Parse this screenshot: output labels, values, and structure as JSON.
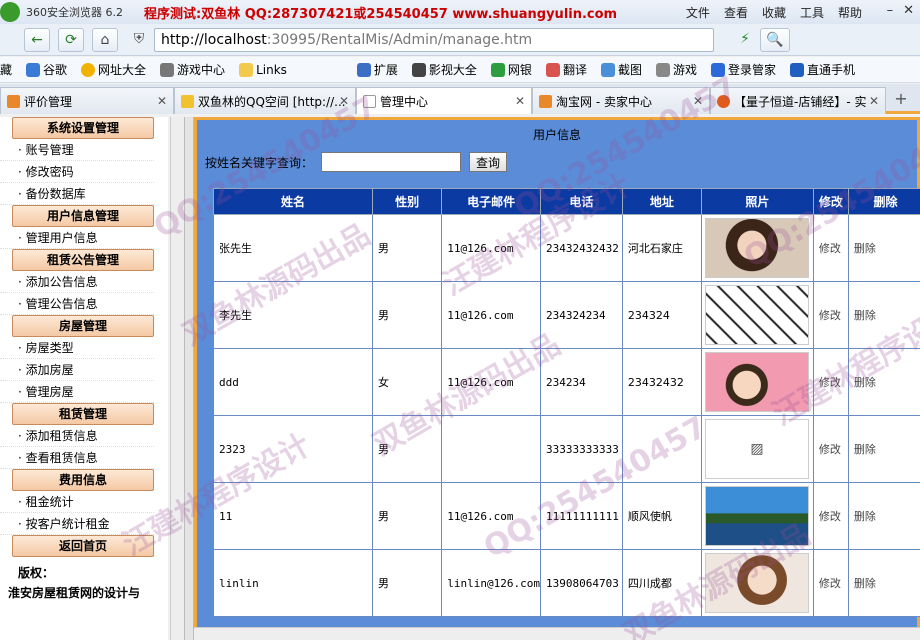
{
  "browser": {
    "app_title": "360安全浏览器 6.2",
    "ad_text": "程序测试:双鱼林 QQ:287307421或254540457 www.shuangyulin.com",
    "menu": [
      "文件",
      "查看",
      "收藏",
      "工具",
      "帮助"
    ],
    "url_host": "http://localhost",
    "url_path": ":30995/RentalMis/Admin/manage.htm",
    "bookmarks": [
      "藏",
      "谷歌",
      "网址大全",
      "游戏中心",
      "Links",
      "扩展",
      "影视大全",
      "网银",
      "翻译",
      "截图",
      "游戏",
      "登录管家",
      "直通手机"
    ],
    "tabs": [
      {
        "label": "评价管理",
        "color": "#e8882a"
      },
      {
        "label": "双鱼林的QQ空间 [http://...",
        "color": "#f2c12e"
      },
      {
        "label": "管理中心",
        "color": "#ffffff"
      },
      {
        "label": "淘宝网 - 卖家中心",
        "color": "#e8882a"
      },
      {
        "label": "【量子恒道-店铺经】- 实",
        "color": "#e05a1a"
      }
    ]
  },
  "sidebar": {
    "sections": [
      {
        "title": "系统设置管理",
        "items": [
          "账号管理",
          "修改密码",
          "备份数据库"
        ]
      },
      {
        "title": "用户信息管理",
        "items": [
          "管理用户信息"
        ]
      },
      {
        "title": "租赁公告管理",
        "items": [
          "添加公告信息",
          "管理公告信息"
        ]
      },
      {
        "title": "房屋管理",
        "items": [
          "房屋类型",
          "添加房屋",
          "管理房屋"
        ]
      },
      {
        "title": "租赁管理",
        "items": [
          "添加租赁信息",
          "查看租赁信息"
        ]
      },
      {
        "title": "费用信息",
        "items": [
          "租金统计",
          "按客户统计租金"
        ]
      },
      {
        "title": "返回首页",
        "items": []
      }
    ],
    "copyright_label": "版权：",
    "copyright_text": "淮安房屋租赁网的设计与"
  },
  "main": {
    "title": "用户信息",
    "search_label": "按姓名关键字查询：",
    "search_value": "",
    "search_button": "查询",
    "columns": [
      "姓名",
      "性别",
      "电子邮件",
      "电话",
      "地址",
      "照片",
      "修改",
      "删除"
    ],
    "rows": [
      {
        "name": "张先生",
        "gender": "男",
        "email": "11@126.com",
        "phone": "23432432432",
        "address": "河北石家庄",
        "photo": "woman-portrait",
        "edit": "修改",
        "delete": "删除"
      },
      {
        "name": "李先生",
        "gender": "男",
        "email": "11@126.com",
        "phone": "234324234",
        "address": "234324",
        "photo": "sketch-drawing",
        "edit": "修改",
        "delete": "删除"
      },
      {
        "name": "ddd",
        "gender": "女",
        "email": "11@126.com",
        "phone": "234234",
        "address": "23432432",
        "photo": "cartoon-girl",
        "edit": "修改",
        "delete": "删除"
      },
      {
        "name": "2323",
        "gender": "男",
        "email": "",
        "phone": "33333333333",
        "address": "",
        "photo": "broken-image",
        "edit": "修改",
        "delete": "删除"
      },
      {
        "name": "11",
        "gender": "男",
        "email": "11@126.com",
        "phone": "11111111111",
        "address": "顺风使帆",
        "photo": "lake-landscape",
        "edit": "修改",
        "delete": "删除"
      },
      {
        "name": "linlin",
        "gender": "男",
        "email": "linlin@126.com",
        "phone": "13908064703",
        "address": "四川成都",
        "photo": "girl-portrait",
        "edit": "修改",
        "delete": "删除"
      }
    ]
  },
  "watermarks": [
    "QQ:254540457",
    "双鱼林源码出品",
    "汪建林程序设计",
    "QQ:254540457",
    "双鱼林源码出品",
    "汪建林程序设计",
    "QQ:254540457",
    "双鱼林源码出品",
    "QQ:254540457",
    "汪建林程序设计"
  ]
}
